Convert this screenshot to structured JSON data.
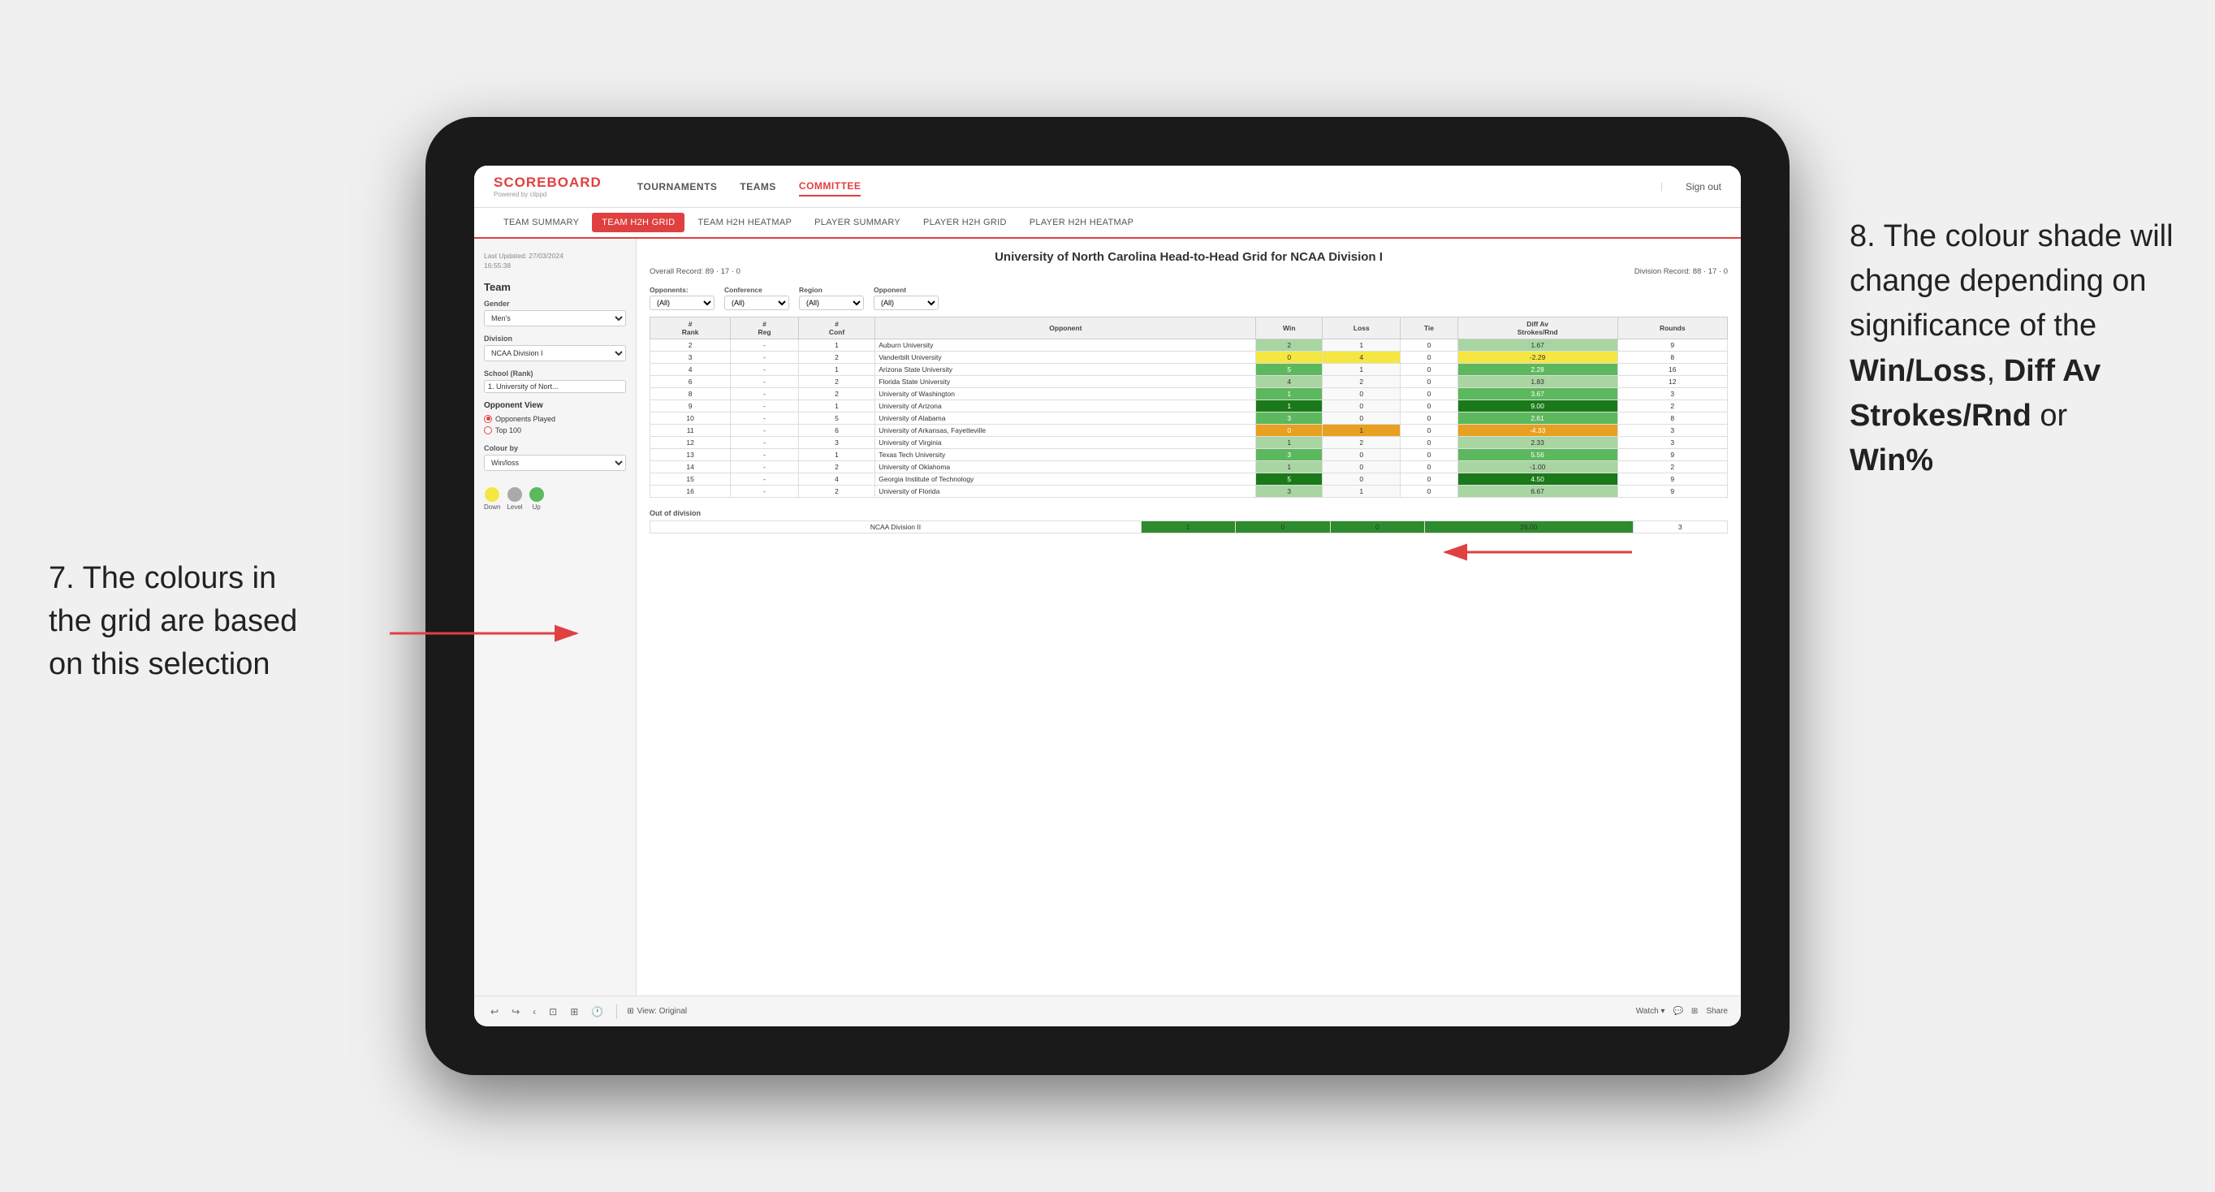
{
  "annotations": {
    "left_title": "7. The colours in the grid are based on this selection",
    "right_title": "8. The colour shade will change depending on significance of the",
    "right_bold1": "Win/Loss",
    "right_comma": ", ",
    "right_bold2": "Diff Av Strokes/Rnd",
    "right_or": " or",
    "right_bold3": "Win%"
  },
  "nav": {
    "logo": "SCOREBOARD",
    "logo_sub": "Powered by clippd",
    "items": [
      "TOURNAMENTS",
      "TEAMS",
      "COMMITTEE"
    ],
    "active": "COMMITTEE",
    "sign_out": "Sign out"
  },
  "sub_nav": {
    "items": [
      "TEAM SUMMARY",
      "TEAM H2H GRID",
      "TEAM H2H HEATMAP",
      "PLAYER SUMMARY",
      "PLAYER H2H GRID",
      "PLAYER H2H HEATMAP"
    ],
    "active": "TEAM H2H GRID"
  },
  "sidebar": {
    "meta": "Last Updated: 27/03/2024\n16:55:38",
    "team_label": "Team",
    "gender_label": "Gender",
    "gender_value": "Men's",
    "division_label": "Division",
    "division_value": "NCAA Division I",
    "school_label": "School (Rank)",
    "school_value": "1. University of Nort...",
    "opponent_view_label": "Opponent View",
    "opponent_played": "Opponents Played",
    "opponent_top100": "Top 100",
    "colour_by_label": "Colour by",
    "colour_by_value": "Win/loss",
    "legend": {
      "down_label": "Down",
      "level_label": "Level",
      "up_label": "Up"
    }
  },
  "grid": {
    "title": "University of North Carolina Head-to-Head Grid for NCAA Division I",
    "overall_record_label": "Overall Record:",
    "overall_record": "89 · 17 · 0",
    "division_record_label": "Division Record:",
    "division_record": "88 · 17 · 0",
    "filters": {
      "opponents_label": "Opponents:",
      "opponents_value": "(All)",
      "conference_label": "Conference",
      "conference_value": "(All)",
      "region_label": "Region",
      "region_value": "(All)",
      "opponent_label": "Opponent",
      "opponent_value": "(All)"
    },
    "columns": [
      "#\nRank",
      "#\nReg",
      "#\nConf",
      "Opponent",
      "Win",
      "Loss",
      "Tie",
      "Diff Av\nStrokes/Rnd",
      "Rounds"
    ],
    "rows": [
      {
        "rank": "2",
        "reg": "-",
        "conf": "1",
        "opponent": "Auburn University",
        "win": 2,
        "loss": 1,
        "tie": 0,
        "diff": "1.67",
        "rounds": 9,
        "win_color": "green_light",
        "diff_color": "green_light"
      },
      {
        "rank": "3",
        "reg": "-",
        "conf": "2",
        "opponent": "Vanderbilt University",
        "win": 0,
        "loss": 4,
        "tie": 0,
        "diff": "-2.29",
        "rounds": 8,
        "win_color": "yellow",
        "diff_color": "yellow"
      },
      {
        "rank": "4",
        "reg": "-",
        "conf": "1",
        "opponent": "Arizona State University",
        "win": 5,
        "loss": 1,
        "tie": 0,
        "diff": "2.28",
        "rounds": 16,
        "win_color": "green_mid",
        "diff_color": "green_mid"
      },
      {
        "rank": "6",
        "reg": "-",
        "conf": "2",
        "opponent": "Florida State University",
        "win": 4,
        "loss": 2,
        "tie": 0,
        "diff": "1.83",
        "rounds": 12,
        "win_color": "green_light",
        "diff_color": "green_light"
      },
      {
        "rank": "8",
        "reg": "-",
        "conf": "2",
        "opponent": "University of Washington",
        "win": 1,
        "loss": 0,
        "tie": 0,
        "diff": "3.67",
        "rounds": 3,
        "win_color": "green_mid",
        "diff_color": "green_mid"
      },
      {
        "rank": "9",
        "reg": "-",
        "conf": "1",
        "opponent": "University of Arizona",
        "win": 1,
        "loss": 0,
        "tie": 0,
        "diff": "9.00",
        "rounds": 2,
        "win_color": "green_dark",
        "diff_color": "green_dark"
      },
      {
        "rank": "10",
        "reg": "-",
        "conf": "5",
        "opponent": "University of Alabama",
        "win": 3,
        "loss": 0,
        "tie": 0,
        "diff": "2.61",
        "rounds": 8,
        "win_color": "green_mid",
        "diff_color": "green_mid"
      },
      {
        "rank": "11",
        "reg": "-",
        "conf": "6",
        "opponent": "University of Arkansas, Fayetteville",
        "win": 0,
        "loss": 1,
        "tie": 0,
        "diff": "-4.33",
        "rounds": 3,
        "win_color": "orange",
        "diff_color": "orange"
      },
      {
        "rank": "12",
        "reg": "-",
        "conf": "3",
        "opponent": "University of Virginia",
        "win": 1,
        "loss": 2,
        "tie": 0,
        "diff": "2.33",
        "rounds": 3,
        "win_color": "green_light",
        "diff_color": "green_light"
      },
      {
        "rank": "13",
        "reg": "-",
        "conf": "1",
        "opponent": "Texas Tech University",
        "win": 3,
        "loss": 0,
        "tie": 0,
        "diff": "5.56",
        "rounds": 9,
        "win_color": "green_mid",
        "diff_color": "green_mid"
      },
      {
        "rank": "14",
        "reg": "-",
        "conf": "2",
        "opponent": "University of Oklahoma",
        "win": 1,
        "loss": 0,
        "tie": 0,
        "diff": "-1.00",
        "rounds": 2,
        "win_color": "green_light",
        "diff_color": "green_light"
      },
      {
        "rank": "15",
        "reg": "-",
        "conf": "4",
        "opponent": "Georgia Institute of Technology",
        "win": 5,
        "loss": 0,
        "tie": 0,
        "diff": "4.50",
        "rounds": 9,
        "win_color": "green_dark",
        "diff_color": "green_dark"
      },
      {
        "rank": "16",
        "reg": "-",
        "conf": "2",
        "opponent": "University of Florida",
        "win": 3,
        "loss": 1,
        "tie": 0,
        "diff": "6.67",
        "rounds": 9,
        "win_color": "green_light",
        "diff_color": "green_light"
      }
    ],
    "out_of_division": {
      "label": "Out of division",
      "rows": [
        {
          "division": "NCAA Division II",
          "win": 1,
          "loss": 0,
          "tie": 0,
          "diff": "26.00",
          "rounds": 3
        }
      ]
    }
  },
  "toolbar": {
    "view_label": "View: Original",
    "watch_label": "Watch ▾",
    "share_label": "Share"
  },
  "colors": {
    "green_dark": "#1a7a1a",
    "green_mid": "#5cb85c",
    "green_light": "#a8d5a2",
    "yellow": "#f5e642",
    "orange": "#e8a020",
    "accent": "#e04040"
  }
}
